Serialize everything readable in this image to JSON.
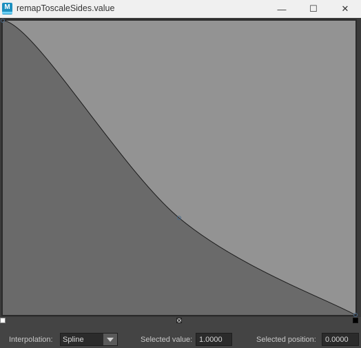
{
  "window": {
    "app_icon_letter": "M",
    "title": "remapToscaleSides.value",
    "buttons": {
      "minimize": "—",
      "maximize": "☐",
      "close": "✕"
    }
  },
  "ramp": {
    "points": [
      {
        "position": 0.0,
        "value": 1.0,
        "selected": false
      },
      {
        "position": 0.5,
        "value": 0.3296,
        "selected": false
      },
      {
        "position": 1.0,
        "value": 0.0,
        "selected": true
      }
    ],
    "colors": {
      "below": "#6a6a6a",
      "above": "#939393",
      "curve": "#1a1a1a",
      "point": "#4a6a8a"
    }
  },
  "controls": {
    "interpolation_label": "Interpolation:",
    "interpolation_value": "Spline",
    "selected_value_label": "Selected value:",
    "selected_value": "1.0000",
    "selected_position_label": "Selected position:",
    "selected_position": "0.0000"
  }
}
